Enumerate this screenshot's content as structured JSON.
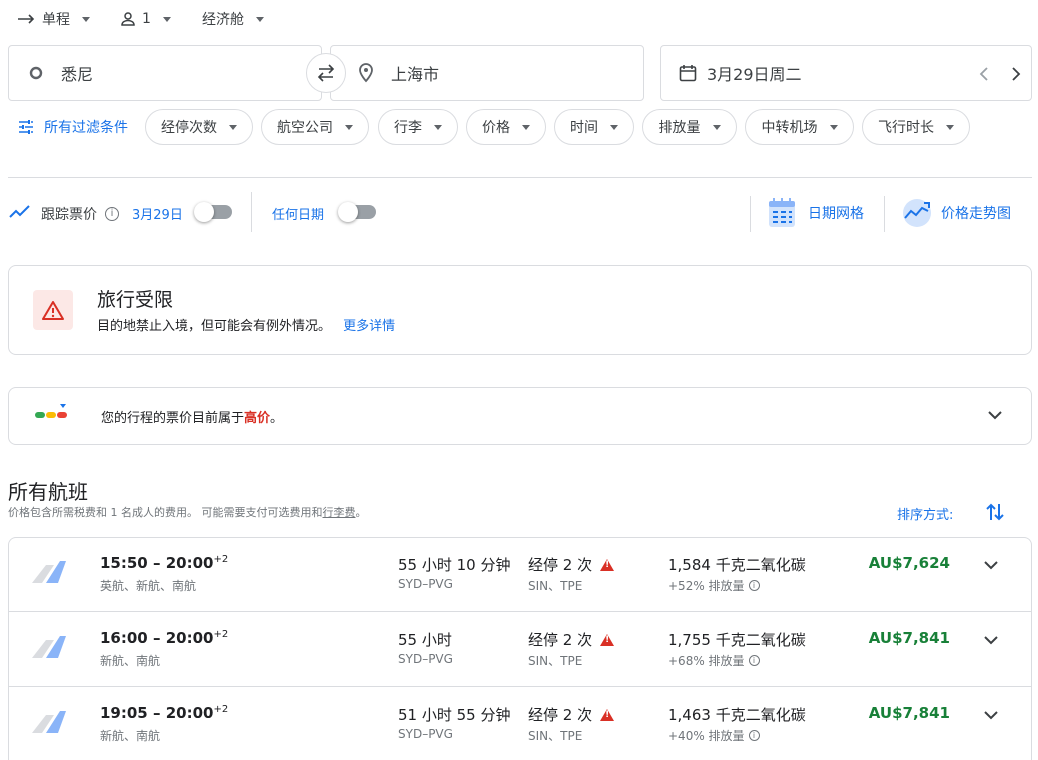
{
  "top": {
    "trip_type": "单程",
    "passengers": "1",
    "cabin": "经济舱"
  },
  "search": {
    "origin": "悉尼",
    "destination": "上海市",
    "date": "3月29日周二"
  },
  "filters": {
    "all_label": "所有过滤条件",
    "chips": [
      "经停次数",
      "航空公司",
      "行李",
      "价格",
      "时间",
      "排放量",
      "中转机场",
      "飞行时长"
    ]
  },
  "tracking": {
    "label": "跟踪票价",
    "date": "3月29日",
    "any_date": "任何日期",
    "date_grid": "日期网格",
    "price_graph": "价格走势图"
  },
  "restriction": {
    "title": "旅行受限",
    "body": "目的地禁止入境，但可能会有例外情况。",
    "link": "更多详情"
  },
  "price_insight": {
    "prefix": "您的行程的票价目前属于",
    "level": "高价",
    "suffix": "。"
  },
  "results": {
    "heading": "所有航班",
    "subtext_prefix": "价格包含所需税费和 1 名成人的费用。 可能需要支付可选费用和",
    "subtext_link": "行李费",
    "subtext_suffix": "。",
    "sort_label": "排序方式:"
  },
  "flights": [
    {
      "time": "15:50 – 20:00",
      "plus": "+2",
      "airlines": "英航、新航、南航",
      "duration": "55 小时 10 分钟",
      "route": "SYD–PVG",
      "stops": "经停 2 次",
      "via": "SIN、TPE",
      "emissions": "1,584 千克二氧化碳",
      "emissions_delta": "+52% 排放量",
      "price": "AU$7,624"
    },
    {
      "time": "16:00 – 20:00",
      "plus": "+2",
      "airlines": "新航、南航",
      "duration": "55 小时",
      "route": "SYD–PVG",
      "stops": "经停 2 次",
      "via": "SIN、TPE",
      "emissions": "1,755 千克二氧化碳",
      "emissions_delta": "+68% 排放量",
      "price": "AU$7,841"
    },
    {
      "time": "19:05 – 20:00",
      "plus": "+2",
      "airlines": "新航、南航",
      "duration": "51 小时 55 分钟",
      "route": "SYD–PVG",
      "stops": "经停 2 次",
      "via": "SIN、TPE",
      "emissions": "1,463 千克二氧化碳",
      "emissions_delta": "+40% 排放量",
      "price": "AU$7,841"
    }
  ],
  "colors": {
    "accent": "#1a73e8",
    "price_green": "#188038",
    "warning_red": "#d93025"
  }
}
